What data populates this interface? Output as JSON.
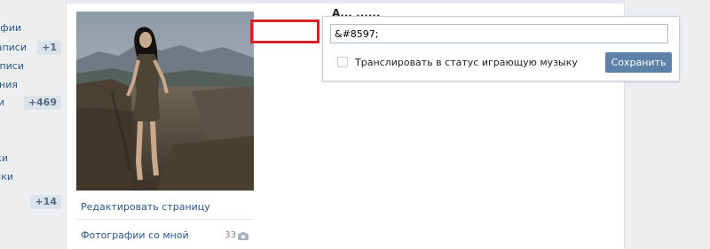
{
  "left_nav": {
    "items": [
      {
        "label": "афии"
      },
      {
        "label": "аписи",
        "badge": "+1"
      },
      {
        "label": "аписи"
      },
      {
        "label": "ния"
      },
      {
        "label": "и",
        "badge": "+469"
      },
      {
        "label": ""
      },
      {
        "label": "ки"
      },
      {
        "label": "йки"
      },
      {
        "label": "",
        "badge": "+14"
      }
    ]
  },
  "profile": {
    "name_partial": "А... ......",
    "photo_alt_icon": "profile-photo",
    "edit_page_label": "Редактировать страницу",
    "photos_with_me_label": "Фотографии со мной",
    "photos_with_me_count": "33"
  },
  "status_popup": {
    "input_value": "&#8597;",
    "broadcast_label": "Транслировать в статус играющую музыку",
    "broadcast_checked": false,
    "save_label": "Сохранить"
  },
  "colors": {
    "accent_button": "#5e81a8",
    "link": "#2a5885",
    "highlight": "#d62226",
    "badge_bg": "#dae2ea"
  },
  "icons": [
    "camera-icon",
    "checkbox"
  ]
}
